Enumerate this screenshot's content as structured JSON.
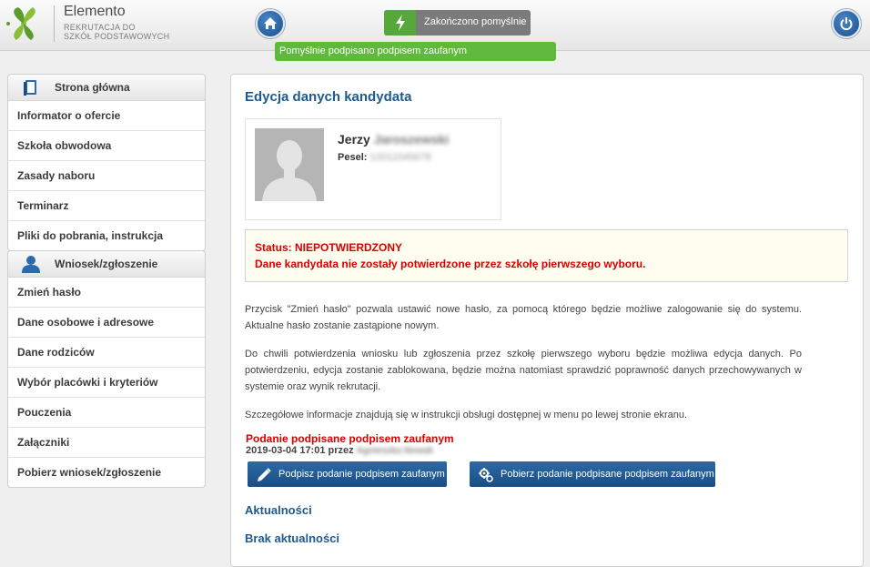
{
  "header": {
    "brand": "Elemento",
    "brand_sub1": "REKRUTACJA DO",
    "brand_sub2": "SZKÓŁ PODSTAWOWYCH"
  },
  "notifications": {
    "toast_main": "Zakończono pomyślnie",
    "toast_sub": "Pomyślnie podpisano podpisem zaufanym"
  },
  "sidebar": {
    "section1": {
      "title": "Strona główna",
      "icon": "book-icon",
      "items": [
        {
          "label": "Informator o ofercie"
        },
        {
          "label": "Szkoła obwodowa"
        },
        {
          "label": "Zasady naboru"
        },
        {
          "label": "Terminarz"
        },
        {
          "label": "Pliki do pobrania, instrukcja"
        }
      ]
    },
    "section2": {
      "title": "Wniosek/zgłoszenie",
      "icon": "user-icon",
      "items": [
        {
          "label": "Zmień hasło"
        },
        {
          "label": "Dane osobowe i adresowe"
        },
        {
          "label": "Dane rodziców"
        },
        {
          "label": "Wybór placówki i kryteriów"
        },
        {
          "label": "Pouczenia"
        },
        {
          "label": "Załączniki"
        },
        {
          "label": "Pobierz wniosek/zgłoszenie"
        }
      ]
    }
  },
  "main": {
    "title": "Edycja danych kandydata",
    "candidate": {
      "first_name": "Jerzy",
      "last_name": "Jaroszewski",
      "pesel_label": "Pesel:",
      "pesel_value": "12012345678"
    },
    "status": {
      "line1": "Status: NIEPOTWIERDZONY",
      "line2": "Dane kandydata nie zostały potwierdzone przez szkołę pierwszego wyboru."
    },
    "paragraphs": [
      "Przycisk \"Zmień hasło\" pozwala ustawić nowe hasło, za pomocą którego będzie możliwe zalogowanie się do systemu. Aktualne hasło zostanie zastąpione nowym.",
      "Do chwili potwierdzenia wniosku lub zgłoszenia przez szkołę pierwszego wyboru będzie możliwa edycja danych. Po potwierdzeniu, edycja zostanie zablokowana, będzie można natomiast sprawdzić poprawność danych przechowywanych w systemie oraz wynik rekrutacji.",
      "Szczegółowe informacje znajdują się w instrukcji obsługi dostępnej w menu po lewej stronie ekranu."
    ],
    "signed": {
      "title": "Podanie podpisane podpisem zaufanym",
      "date": "2019-03-04 17:01 przez",
      "signer": "Agnieszka Nowak"
    },
    "buttons": {
      "sign": "Podpisz podanie podpisem zaufanym",
      "download": "Pobierz podanie podpisane podpisem zaufanym"
    },
    "news_title": "Aktualności",
    "news_empty": "Brak aktualności"
  },
  "colors": {
    "accent_blue": "#1e5a8f",
    "status_red": "#d90000",
    "success_green": "#5fb93d"
  }
}
